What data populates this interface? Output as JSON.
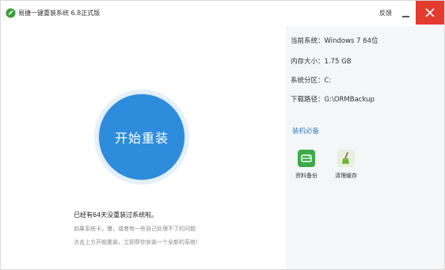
{
  "title_bar": {
    "app_title": "易捷一键重装系统 6.8正式版",
    "feedback_label": "反馈",
    "minimize_icon": "minimize-icon",
    "close_icon": "close-icon"
  },
  "main": {
    "start_button_label": "开始重装",
    "status_text": "已经有64天没重装过系统啦。",
    "hint_line_1": "如果系统卡，慢，或者有一些自己处理不了的问题",
    "hint_line_2": "点击上方开始重装，立即帮你安装一个全新的系统！"
  },
  "system_info": {
    "items": [
      {
        "label": "当前系统：",
        "value": "Windows 7 64位"
      },
      {
        "label": "内存大小：",
        "value": "1.75 GB"
      },
      {
        "label": "系统分区：",
        "value": "C:"
      },
      {
        "label": "下载路径：",
        "value": "G:\\ORMBackup"
      }
    ]
  },
  "tools": {
    "section_title": "装机必备",
    "items": [
      {
        "label": "资料备份",
        "icon": "backup-icon"
      },
      {
        "label": "清理缓存",
        "icon": "broom-icon"
      }
    ]
  },
  "colors": {
    "accent": "#2d8cdc",
    "close": "#e53b2f",
    "section_title": "#3a7fc4",
    "backup_icon": "#3bab48"
  }
}
